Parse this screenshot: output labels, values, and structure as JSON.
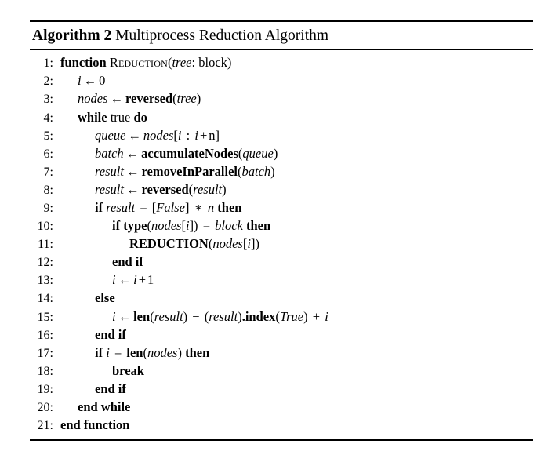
{
  "caption": {
    "label": "Algorithm 2",
    "title": "Multiprocess Reduction Algorithm"
  },
  "algorithm": {
    "lines": [
      {
        "num": "1:",
        "indent": 0,
        "text": "function REDUCTION(tree: block)"
      },
      {
        "num": "2:",
        "indent": 1,
        "text": "i ← 0"
      },
      {
        "num": "3:",
        "indent": 1,
        "text": "nodes ← reversed(tree)"
      },
      {
        "num": "4:",
        "indent": 1,
        "text": "while true do"
      },
      {
        "num": "5:",
        "indent": 2,
        "text": "queue ← nodes[i : i + n]"
      },
      {
        "num": "6:",
        "indent": 2,
        "text": "batch ← accumulateNodes(queue)"
      },
      {
        "num": "7:",
        "indent": 2,
        "text": "result ← removeInParallel(batch)"
      },
      {
        "num": "8:",
        "indent": 2,
        "text": "result ← reversed(result)"
      },
      {
        "num": "9:",
        "indent": 2,
        "text": "if result = [False] ∗ n then"
      },
      {
        "num": "10:",
        "indent": 3,
        "text": "if type(nodes[i]) = block then"
      },
      {
        "num": "11:",
        "indent": 4,
        "text": "REDUCTION(nodes[i])"
      },
      {
        "num": "12:",
        "indent": 3,
        "text": "end if"
      },
      {
        "num": "13:",
        "indent": 3,
        "text": "i ← i + 1"
      },
      {
        "num": "14:",
        "indent": 2,
        "text": "else"
      },
      {
        "num": "15:",
        "indent": 3,
        "text": "i ← len(result) − (result).index(True) + i"
      },
      {
        "num": "16:",
        "indent": 2,
        "text": "end if"
      },
      {
        "num": "17:",
        "indent": 2,
        "text": "if i = len(nodes) then"
      },
      {
        "num": "18:",
        "indent": 3,
        "text": "break"
      },
      {
        "num": "19:",
        "indent": 2,
        "text": "end if"
      },
      {
        "num": "20:",
        "indent": 1,
        "text": "end while"
      },
      {
        "num": "21:",
        "indent": 0,
        "text": "end function"
      }
    ]
  },
  "colors": {
    "text": "#000000",
    "rule": "#000000",
    "background": "#ffffff"
  }
}
